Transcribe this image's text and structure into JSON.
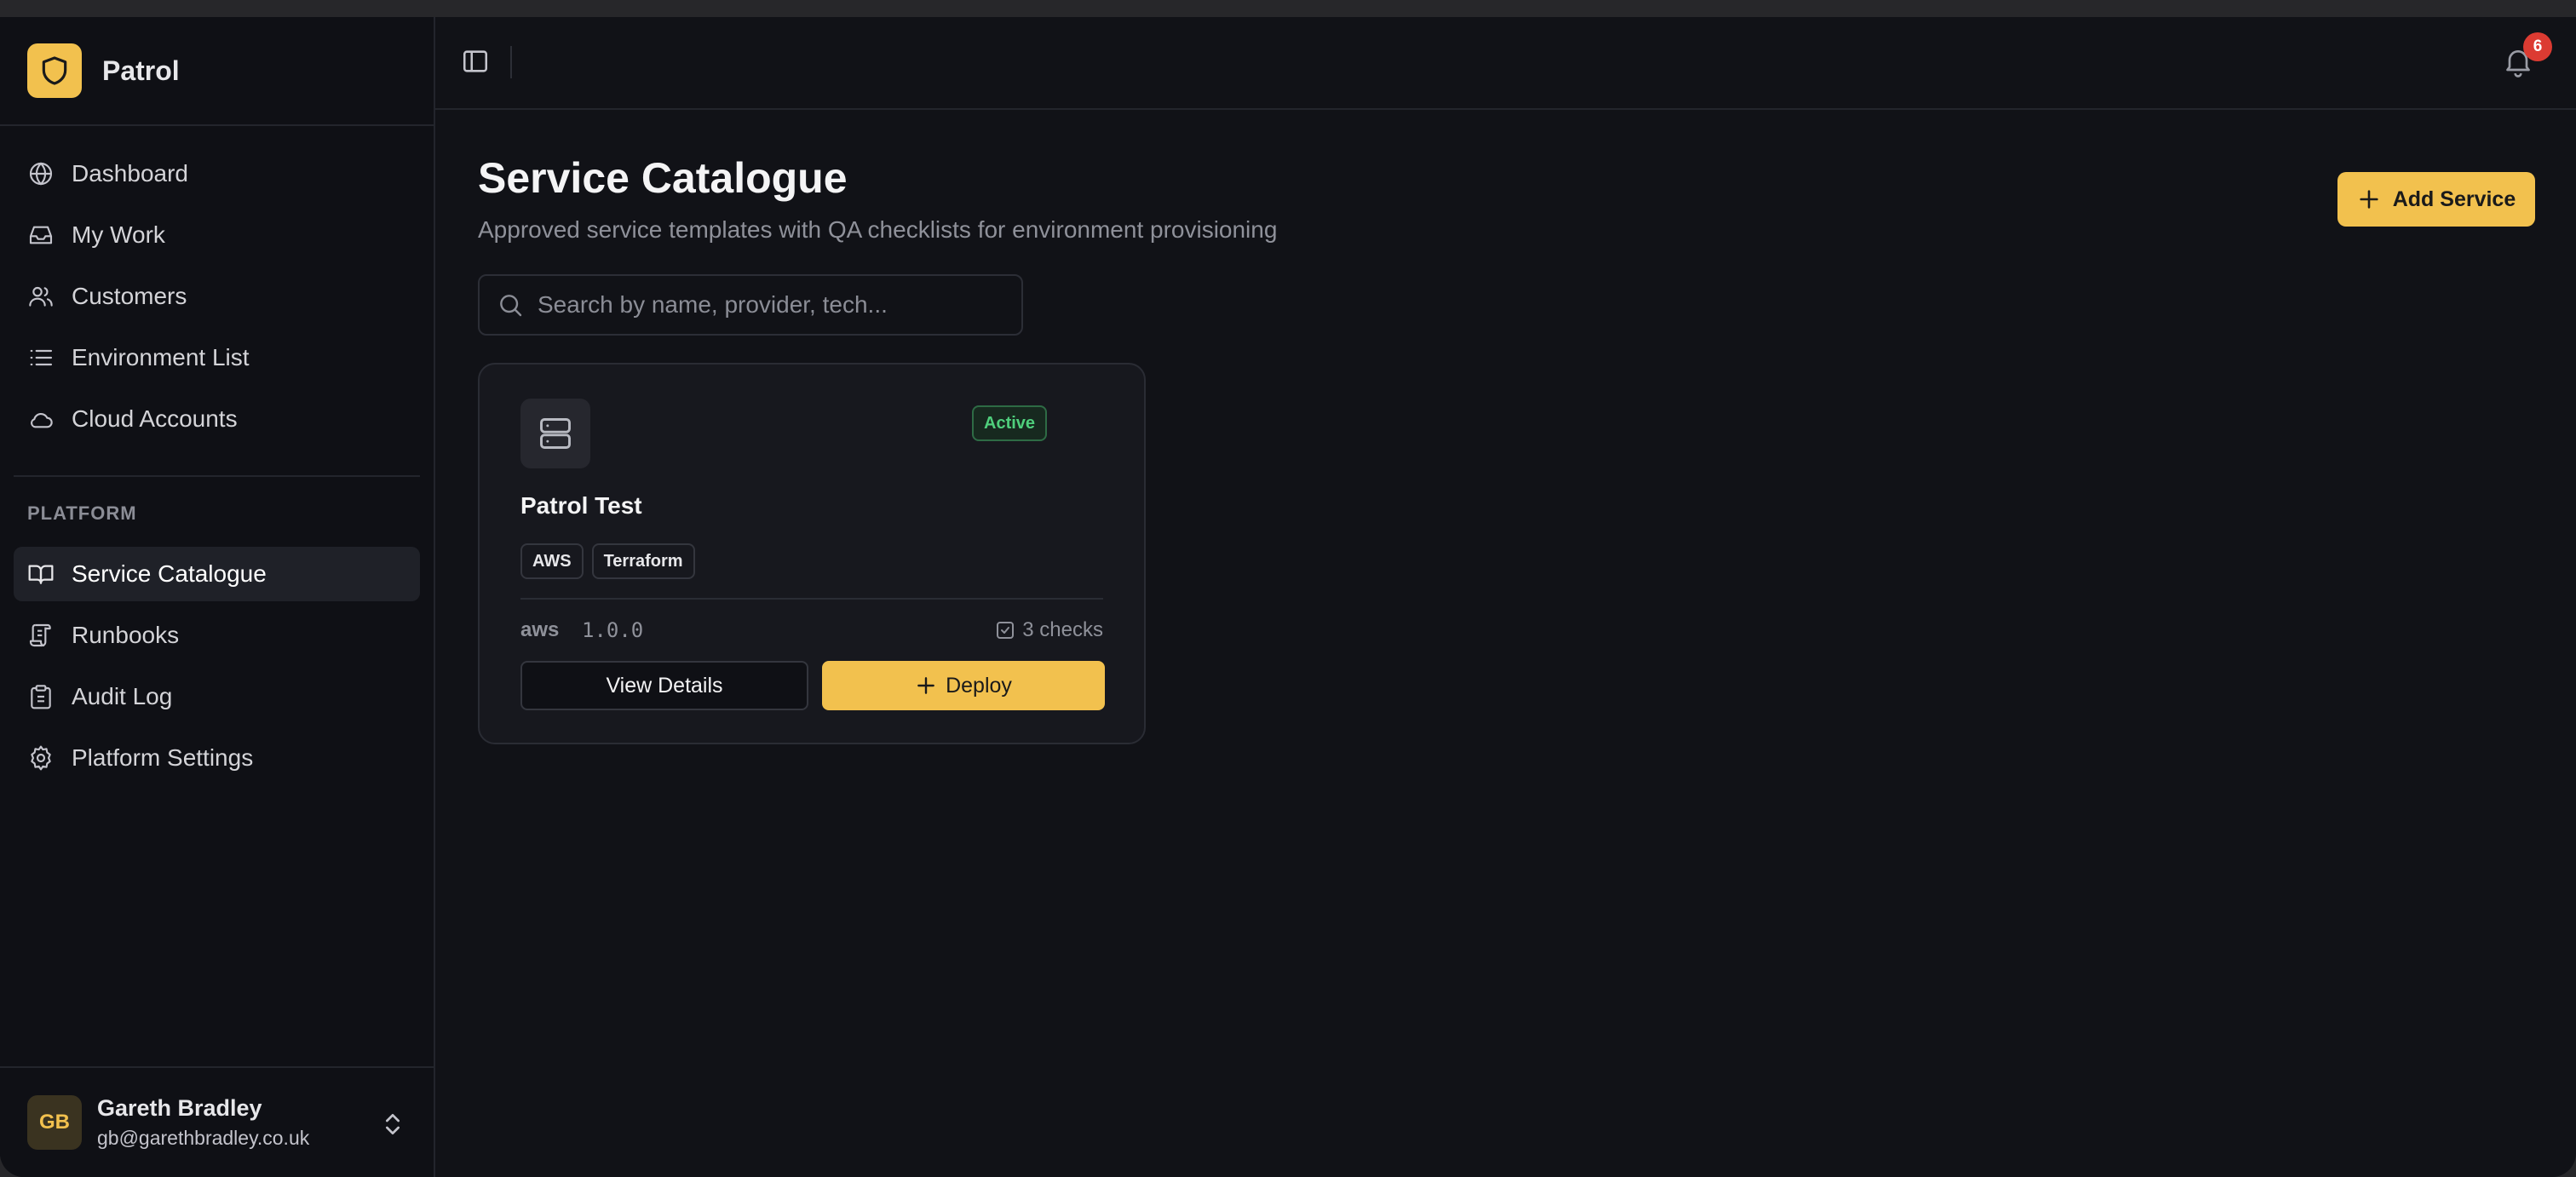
{
  "brand": {
    "name": "Patrol",
    "icon": "shield-icon"
  },
  "nav": {
    "items": [
      {
        "label": "Dashboard",
        "icon": "globe-icon"
      },
      {
        "label": "My Work",
        "icon": "inbox-icon"
      },
      {
        "label": "Customers",
        "icon": "users-icon"
      },
      {
        "label": "Environment List",
        "icon": "list-icon"
      },
      {
        "label": "Cloud Accounts",
        "icon": "cloud-icon"
      }
    ],
    "section_label": "PLATFORM",
    "platform_items": [
      {
        "label": "Service Catalogue",
        "icon": "book-open-icon",
        "active": true
      },
      {
        "label": "Runbooks",
        "icon": "scroll-icon"
      },
      {
        "label": "Audit Log",
        "icon": "clipboard-icon"
      },
      {
        "label": "Platform Settings",
        "icon": "gear-icon"
      }
    ]
  },
  "user": {
    "initials": "GB",
    "name": "Gareth Bradley",
    "email": "gb@garethbradley.co.uk"
  },
  "topbar": {
    "notification_count": "6"
  },
  "page": {
    "title": "Service Catalogue",
    "subtitle": "Approved service templates with QA checklists for environment provisioning",
    "add_button": "Add Service",
    "search_placeholder": "Search by name, provider, tech..."
  },
  "services": [
    {
      "name": "Patrol Test",
      "status": "Active",
      "tags": [
        "AWS",
        "Terraform"
      ],
      "provider": "aws",
      "version": "1.0.0",
      "checks": "3 checks",
      "view_label": "View Details",
      "deploy_label": "Deploy"
    }
  ],
  "colors": {
    "accent": "#f2c14e",
    "background": "#111217",
    "status_active": "#4fcf7c",
    "badge": "#dc3b32"
  }
}
